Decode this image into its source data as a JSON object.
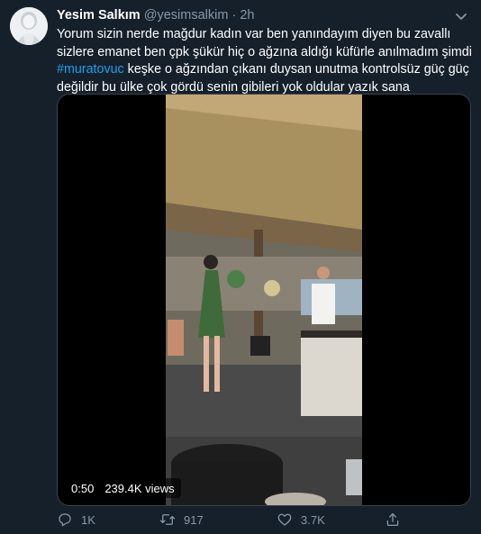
{
  "tweet": {
    "author_name": "Yesim Salkım",
    "author_handle": "@yesimsalkim",
    "separator": "·",
    "time": "2h",
    "text_part1": "Yorum sizin nerde mağdur  kadın var ben yanındayım diyen bu zavallı sizlere emanet ben çpk şükür hiç o ağzına aldığı küfürle anılmadım şimdi ",
    "hashtag": "#muratovuc",
    "text_part2": " keşke o ağzından çıkanı duysan unutma kontrolsüz güç güç değildir bu ülke çok gördü senin gibileri yok oldular yazık sana"
  },
  "video": {
    "elapsed": "0:50",
    "views": "239.4K views"
  },
  "actions": {
    "reply_count": "1K",
    "retweet_count": "917",
    "like_count": "3.7K"
  },
  "icons": {
    "avatar": "avatar-image",
    "more": "chevron-down-icon",
    "reply": "reply-icon",
    "retweet": "retweet-icon",
    "like": "heart-icon",
    "share": "share-icon"
  },
  "colors": {
    "background": "#15202b",
    "secondary_text": "#8899a6",
    "link": "#1da1f2",
    "border": "#38444d"
  }
}
